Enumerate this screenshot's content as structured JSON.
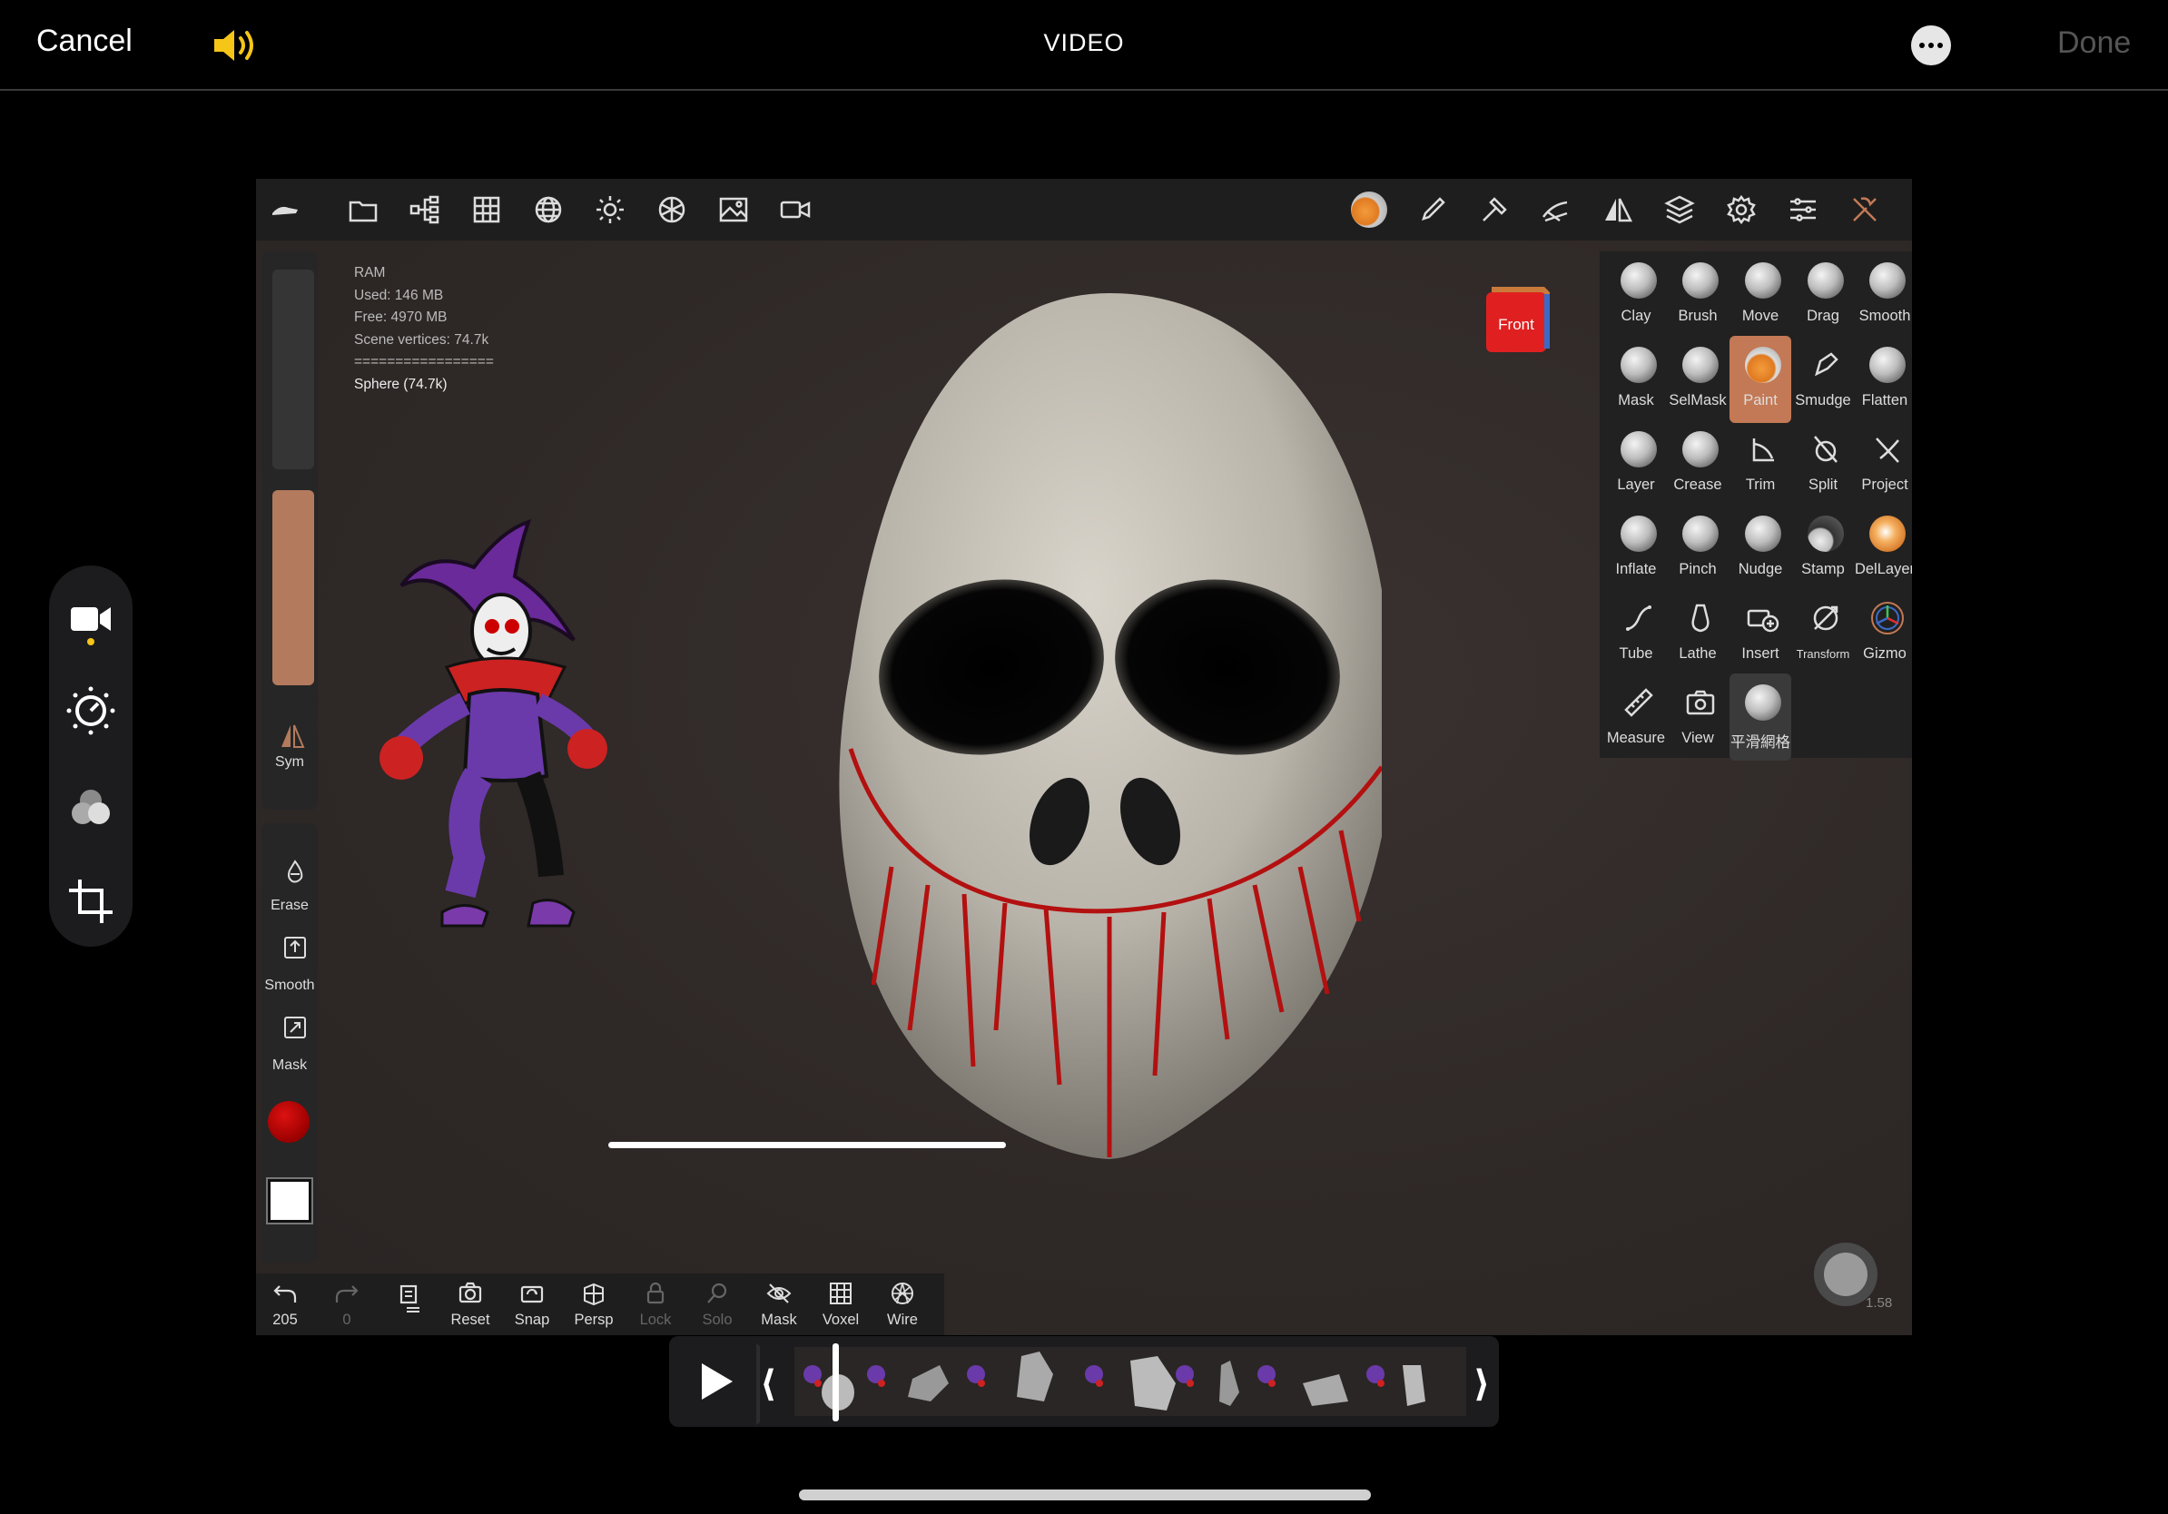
{
  "header": {
    "cancel": "Cancel",
    "title": "VIDEO",
    "done": "Done",
    "speaker_icon": "speaker-icon",
    "more_icon": "more-icon"
  },
  "edit_tools": [
    "video-camera-icon",
    "adjust-dial-icon",
    "filters-icon",
    "crop-rotate-icon"
  ],
  "app": {
    "top_icons": [
      "tool-hand-icon",
      "folder-icon",
      "scene-tree-icon",
      "grid-icon",
      "sphere-wire-icon",
      "sun-icon",
      "material-icon",
      "image-icon",
      "camera-icon",
      "paint-ball-icon",
      "pen-icon",
      "hammer-icon",
      "brush-stroke-icon",
      "symmetry-icon",
      "layers-icon",
      "gear-icon",
      "sliders-icon",
      "tools-icon"
    ],
    "info": {
      "ram": "RAM",
      "used": "Used: 146 MB",
      "free": "Free: 4970 MB",
      "vertices": "Scene vertices: 74.7k",
      "divider": "=================",
      "mesh": "Sphere (74.7k)"
    },
    "left_panel": {
      "sym": "Sym",
      "erase": "Erase",
      "smooth": "Smooth",
      "mask": "Mask",
      "paint_color": "#b00000"
    },
    "view_cube": "Front",
    "tools": [
      [
        "Clay",
        "Brush",
        "Move",
        "Drag",
        "Smooth"
      ],
      [
        "Mask",
        "SelMask",
        "Paint",
        "Smudge",
        "Flatten"
      ],
      [
        "Layer",
        "Crease",
        "Trim",
        "Split",
        "Project"
      ],
      [
        "Inflate",
        "Pinch",
        "Nudge",
        "Stamp",
        "DelLayer"
      ],
      [
        "Tube",
        "Lathe",
        "Insert",
        "Transform",
        "Gizmo"
      ],
      [
        "Measure",
        "View",
        "平滑網格"
      ]
    ],
    "active_tool": "Paint",
    "bottom": {
      "undo": "205",
      "redo": "0",
      "reset": "Reset",
      "snap": "Snap",
      "persp": "Persp",
      "lock": "Lock",
      "solo": "Solo",
      "mask": "Mask",
      "voxel": "Voxel",
      "wire": "Wire"
    },
    "zoom": "1.58"
  },
  "timeline": {
    "play_icon": "play-icon"
  }
}
